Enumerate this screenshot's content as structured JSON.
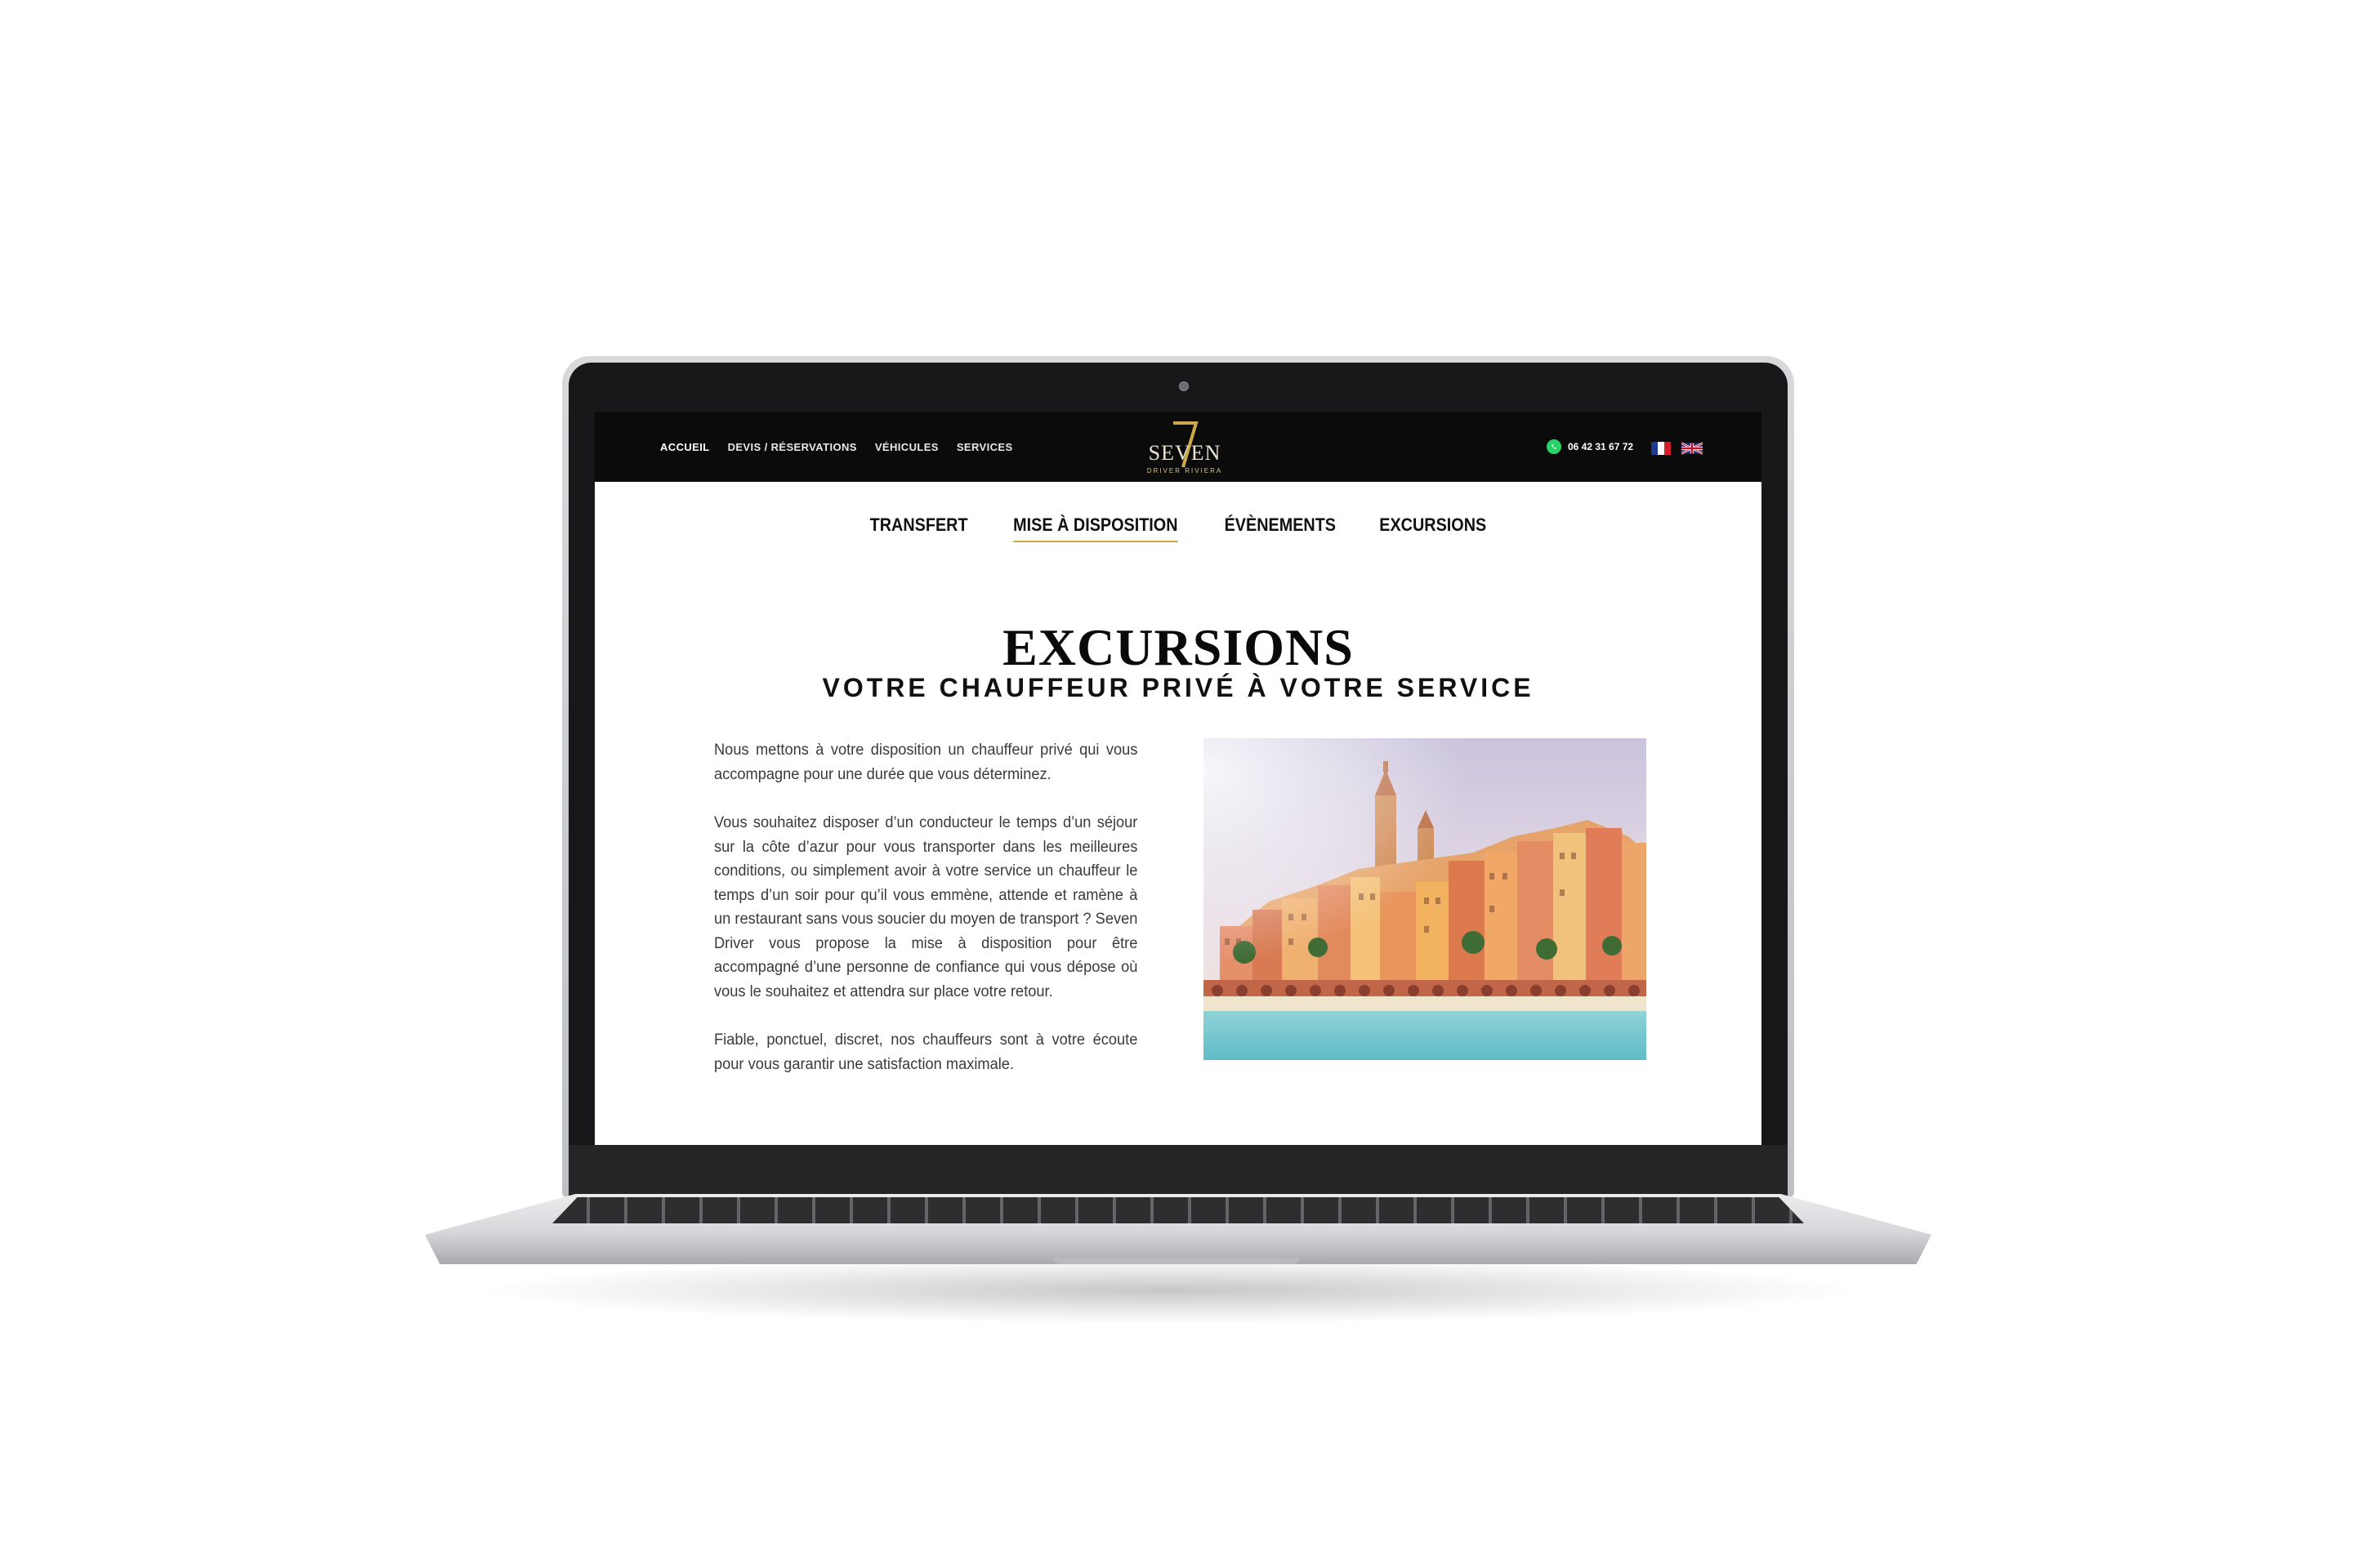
{
  "header": {
    "nav": [
      {
        "label": "ACCUEIL"
      },
      {
        "label": "DEVIS / RÉSERVATIONS"
      },
      {
        "label": "VÉHICULES"
      },
      {
        "label": "SERVICES"
      }
    ],
    "logo": {
      "main": "SEVEN",
      "sub": "DRIVER RIVIERA"
    },
    "phone": "06 42 31 67 72",
    "languages": [
      "fr-flag-icon",
      "uk-flag-icon"
    ]
  },
  "sub_nav": [
    {
      "label": "TRANSFERT"
    },
    {
      "label": "MISE À DISPOSITION"
    },
    {
      "label": "ÉVÈNEMENTS"
    },
    {
      "label": "EXCURSIONS"
    }
  ],
  "main": {
    "title": "EXCURSIONS",
    "subtitle": "VOTRE CHAUFFEUR PRIVÉ À VOTRE SERVICE",
    "paragraphs": [
      "Nous mettons à votre disposition un chauffeur privé qui vous accompagne pour une durée que vous déterminez.",
      "Vous souhaitez disposer d’un conducteur le temps d’un séjour sur la côte d’azur pour vous transporter dans les meilleures conditions, ou simplement avoir à votre service un chauffeur le temps d’un soir pour qu’il vous emmène, attende et ramène à un restaurant sans vous soucier du moyen de transport ? Seven Driver vous propose la mise à disposition pour être accompagné d’une personne de confiance qui vous dépose où vous le souhaitez et attendra sur place votre retour.",
      "Fiable, ponctuel, discret, nos chauffeurs sont à votre écoute pour vous garantir une satisfaction maximale."
    ],
    "image": "menton-coastal-town-photo"
  },
  "colors": {
    "header_bg": "#0b0b0b",
    "accent_gold": "#c9a94a",
    "whatsapp_green": "#25d366"
  }
}
